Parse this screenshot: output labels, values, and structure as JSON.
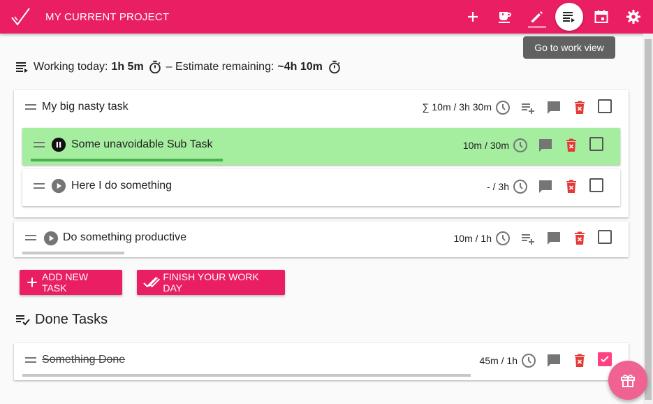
{
  "header": {
    "project_title": "MY CURRENT PROJECT",
    "tooltip": "Go to work view",
    "brand_color": "#e91e63",
    "icons": [
      "add-icon",
      "coffee-icon",
      "edit-icon",
      "work-view-icon",
      "calendar-icon",
      "settings-icon"
    ]
  },
  "summary": {
    "working_label": "Working today:",
    "working_value": "1h 5m",
    "separator": "– Estimate remaining:",
    "estimate_value": "~4h 10m"
  },
  "tasks": {
    "t1": {
      "title": "My big nasty task",
      "time": "∑ 10m / 3h 30m"
    },
    "t1_sub1": {
      "title": "Some unavoidable Sub Task",
      "time": "10m / 30m",
      "progress": 0.33,
      "state": "running"
    },
    "t1_sub2": {
      "title": "Here I do something",
      "time": "- / 3h",
      "state": "paused"
    },
    "t2": {
      "title": "Do something productive",
      "time": "10m / 1h",
      "progress": 0.17
    }
  },
  "buttons": {
    "add_task": "ADD NEW TASK",
    "finish_day": "FINISH YOUR WORK DAY"
  },
  "done": {
    "heading": "Done Tasks",
    "t1": {
      "title": "Something Done",
      "time": "45m / 1h",
      "progress": 0.75,
      "checked": true
    }
  },
  "colors": {
    "active_row": "#a5eea0",
    "progress_active": "#4caf50",
    "progress_idle": "#c7c7c7",
    "delete": "#e53935",
    "fab": "#f06292"
  }
}
